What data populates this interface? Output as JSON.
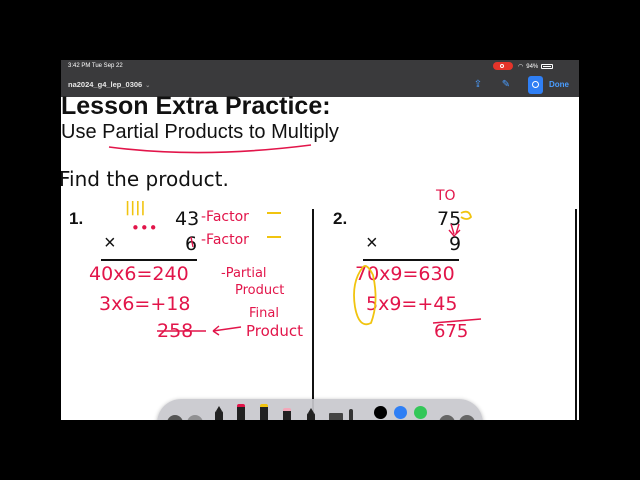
{
  "status_bar": {
    "time": "3:42 PM  Tue Sep 22",
    "battery": "94%"
  },
  "toolbar": {
    "document_name": "na2024_g4_lep_0306",
    "done_label": "Done",
    "accent_color": "#2f7ff5"
  },
  "document": {
    "title": "Lesson Extra Practice:",
    "subtitle": "Use Partial Products to Multiply",
    "instruction": "Find the product.",
    "problem1": {
      "number": "1.",
      "top": "43",
      "bottom": "6",
      "operator": "×"
    },
    "problem2": {
      "number": "2.",
      "top": "75",
      "bottom": "9",
      "operator": "×"
    }
  },
  "annotations": {
    "problem1": {
      "tally": "||||",
      "dots": "•••",
      "factor_label_1": "-Factor",
      "factor_label_2": "-Factor",
      "step1": "40x6=240",
      "partial_label_1": "-Partial",
      "partial_label_2": "Product",
      "step2": "3x6=+18",
      "final_label_1": "Final",
      "final_label_2": "Product",
      "answer": "258"
    },
    "problem2": {
      "place_labels": "TO",
      "step1": "70x9=630",
      "step2": "5x9=+45",
      "answer": "675"
    },
    "ink_colors": {
      "red": "#e2154a",
      "yellow": "#f1c40f"
    }
  },
  "markup_palette": {
    "colors": [
      "#000000",
      "#2f7ff5",
      "#34c759",
      "#f1c40f",
      "#e2154a"
    ]
  }
}
